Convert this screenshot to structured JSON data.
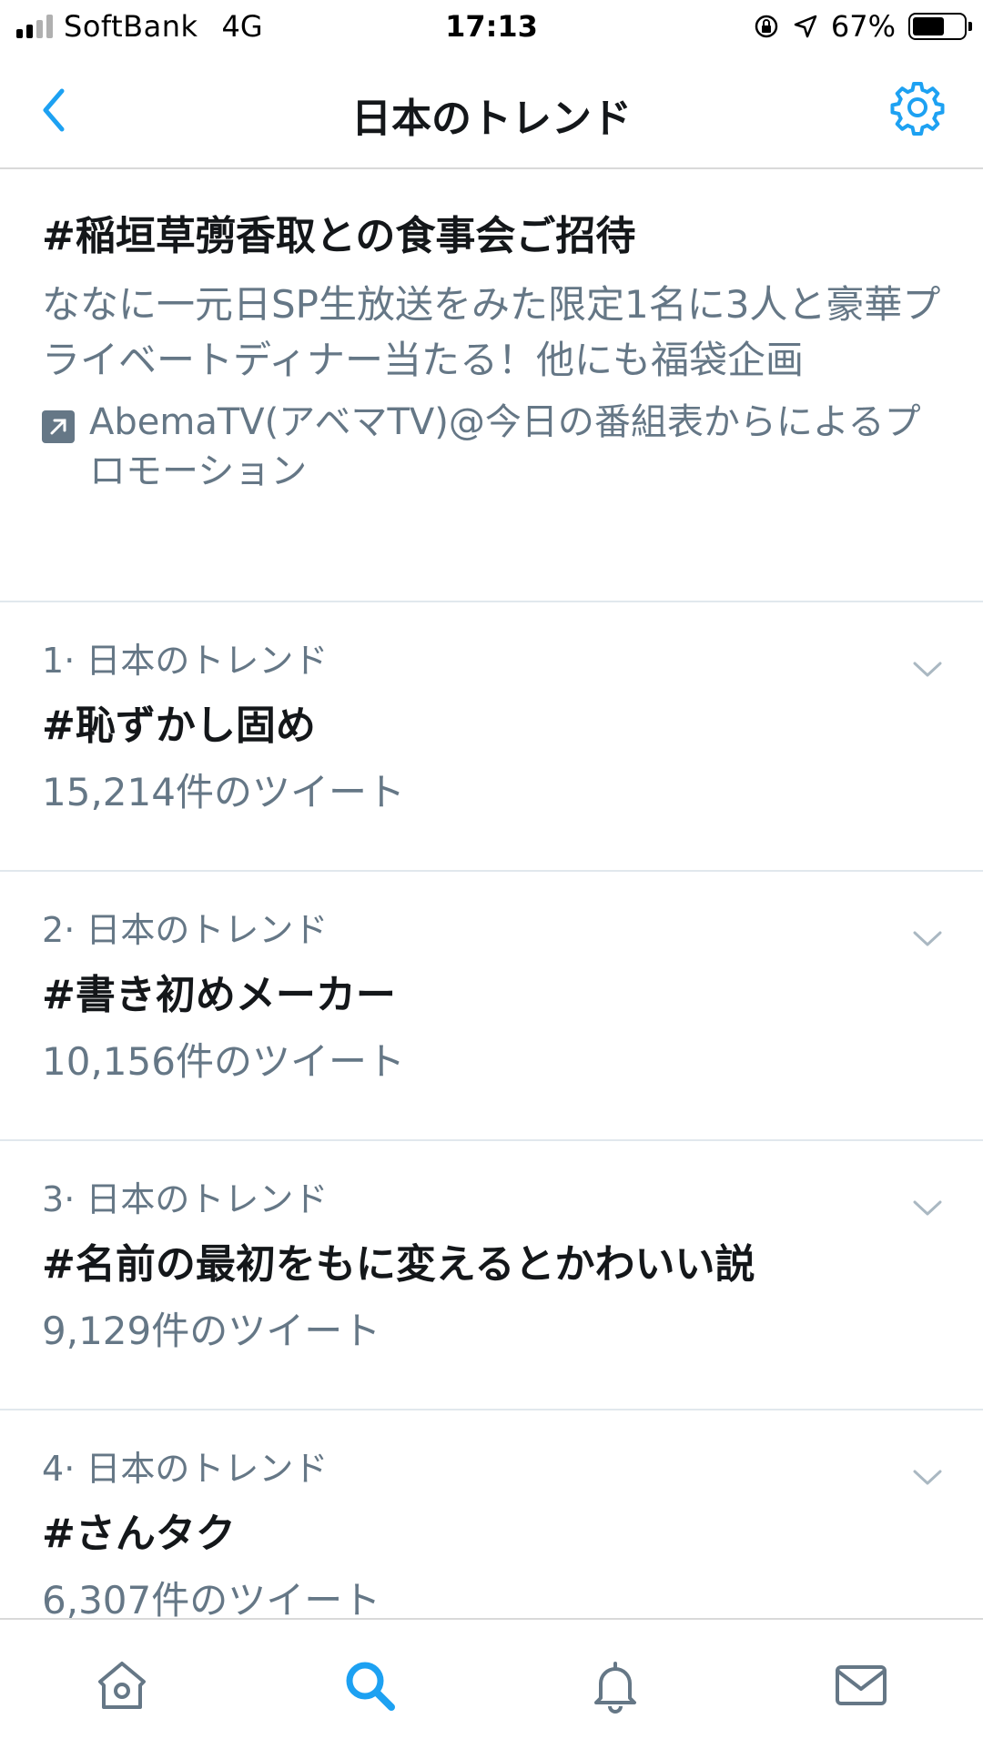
{
  "status_bar": {
    "carrier": "SoftBank",
    "network": "4G",
    "time": "17:13",
    "battery_percent": "67%",
    "battery_level": 0.67
  },
  "nav": {
    "title": "日本のトレンド",
    "back_icon": "chevron-left-icon",
    "settings_icon": "gear-icon",
    "accent_color": "#1da1f2"
  },
  "promoted": {
    "title": "#稲垣草彅香取との食事会ご招待",
    "description": "ななに一元日SP生放送をみた限定1名に3人と豪華プライベートディナー当たる！他にも福袋企画",
    "source": "AbemaTV(アベマTV)@今日の番組表からによるプロモーション",
    "icon": "promoted-arrow-icon"
  },
  "trends": [
    {
      "rank": "1",
      "context": "日本のトレンド",
      "name": "#恥ずかし固め",
      "count": "15,214件のツイート"
    },
    {
      "rank": "2",
      "context": "日本のトレンド",
      "name": "#書き初めメーカー",
      "count": "10,156件のツイート"
    },
    {
      "rank": "3",
      "context": "日本のトレンド",
      "name": "#名前の最初をもに変えるとかわいい説",
      "count": "9,129件のツイート"
    },
    {
      "rank": "4",
      "context": "日本のトレンド",
      "name": "#さんタク",
      "count": "6,307件のツイート"
    }
  ],
  "tabbar": {
    "items": [
      "home-icon",
      "search-icon",
      "bell-icon",
      "mail-icon"
    ],
    "active": "search-icon",
    "active_color": "#1da1f2",
    "inactive_color": "#657786"
  }
}
